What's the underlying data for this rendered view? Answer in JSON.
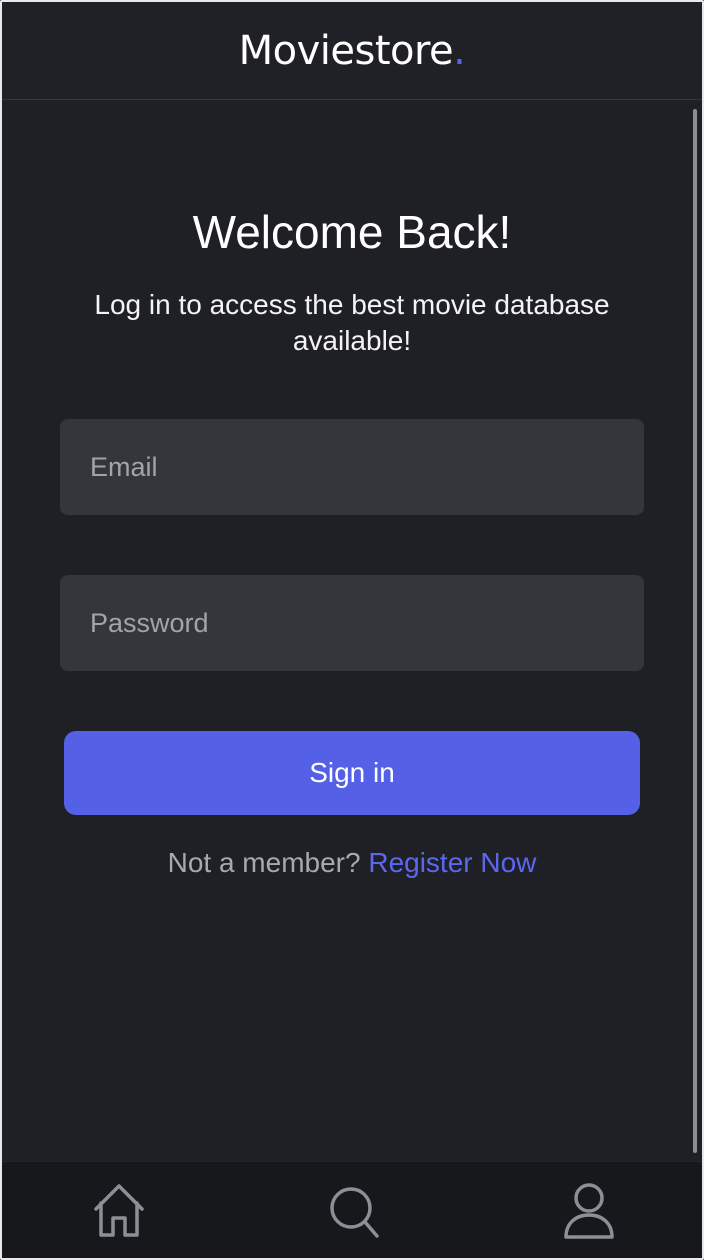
{
  "header": {
    "brand_name": "Moviestore",
    "brand_dot": "."
  },
  "login": {
    "title": "Welcome Back!",
    "subtitle": "Log in to access the best movie database available!",
    "email_placeholder": "Email",
    "password_placeholder": "Password",
    "sign_in_label": "Sign in",
    "member_prompt": "Not a member?",
    "register_label": "Register Now"
  },
  "bottom_nav": {
    "items": [
      {
        "icon": "home-icon",
        "label": ""
      },
      {
        "icon": "search-icon",
        "label": ""
      },
      {
        "icon": "user-icon",
        "label": ""
      }
    ]
  },
  "theme": {
    "background": "#1f2025",
    "input_background": "#35363c",
    "accent": "#5461e6",
    "link": "#5c67f0",
    "muted_text": "#a7a9b0"
  }
}
